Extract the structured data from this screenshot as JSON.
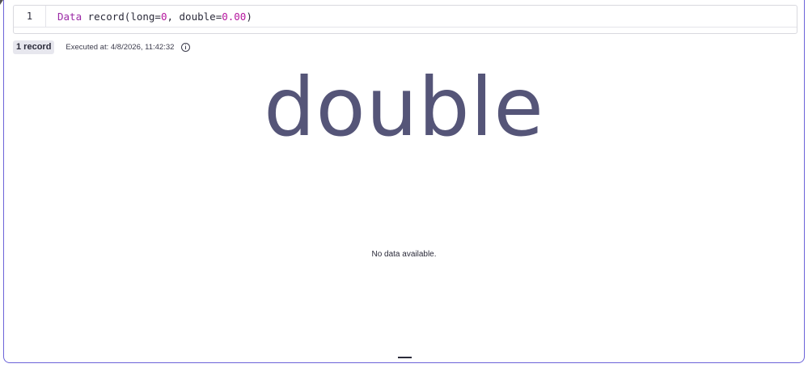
{
  "editor": {
    "line_number": "1",
    "code": {
      "keyword": "Data",
      "part1": " record(long=",
      "num1": "0",
      "part2": ", double=",
      "num2": "0.00",
      "part3": ")"
    }
  },
  "result": {
    "record_count": "1 record",
    "executed_at": "Executed at: 4/8/2026, 11:42:32",
    "single_value": "double",
    "empty_message": "No data available."
  },
  "colors": {
    "accent_border": "#6c63d9",
    "keyword": "#9b2aa6",
    "number": "#b5179e",
    "big_value": "#555578"
  }
}
